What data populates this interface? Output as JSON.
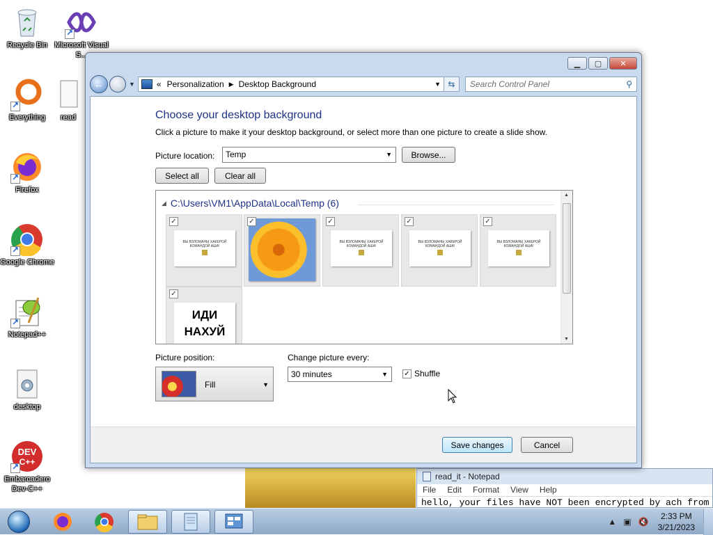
{
  "desktop": {
    "icons": [
      {
        "label": "Recycle Bin"
      },
      {
        "label": "Microsoft Visual S..."
      },
      {
        "label": "Everything"
      },
      {
        "label": "read"
      },
      {
        "label": "Firefox"
      },
      {
        "label": "Google Chrome"
      },
      {
        "label": "Notepad++"
      },
      {
        "label": "desktop"
      },
      {
        "label": "Embarcadero Dev-C++"
      }
    ]
  },
  "window": {
    "breadcrumb": [
      "Personalization",
      "Desktop Background"
    ],
    "search_placeholder": "Search Control Panel",
    "title": "Choose your desktop background",
    "subtitle": "Click a picture to make it your desktop background, or select more than one picture to create a slide show.",
    "picture_location_label": "Picture location:",
    "picture_location_value": "Temp",
    "browse_label": "Browse...",
    "select_all_label": "Select all",
    "clear_all_label": "Clear all",
    "group_header": "C:\\Users\\VM1\\AppData\\Local\\Temp (6)",
    "thumbnails": [
      {
        "kind": "ransom",
        "checked": true,
        "text": "ВЫ ВЗЛОМАНЫ ХАКЕРОЙ КОМАНДОЙ АША!"
      },
      {
        "kind": "flower",
        "checked": true,
        "text": ""
      },
      {
        "kind": "ransom",
        "checked": true,
        "text": "ВЫ ВЗЛОМАНЫ ХАКЕРОЙ КОМАНДОЙ АША!"
      },
      {
        "kind": "ransom",
        "checked": true,
        "text": "ВЫ ВЗЛОМАНЫ ХАКЕРОЙ КОМАНДОЙ АША!"
      },
      {
        "kind": "ransom",
        "checked": true,
        "text": "ВЫ ВЗЛОМАНЫ ХАКЕРОЙ КОМАНДОЙ АША!"
      },
      {
        "kind": "big",
        "checked": true,
        "text": "ИДИ НАХУЙ"
      }
    ],
    "picture_position_label": "Picture position:",
    "picture_position_value": "Fill",
    "change_picture_label": "Change picture every:",
    "change_picture_value": "30 minutes",
    "shuffle_label": "Shuffle",
    "shuffle_checked": true,
    "save_label": "Save changes",
    "cancel_label": "Cancel"
  },
  "notepad": {
    "title": "read_it - Notepad",
    "menu": [
      "File",
      "Edit",
      "Format",
      "View",
      "Help"
    ],
    "text": "hello, your files have NOT been encrypted by ach from"
  },
  "taskbar": {
    "time": "2:33 PM",
    "date": "3/21/2023"
  }
}
